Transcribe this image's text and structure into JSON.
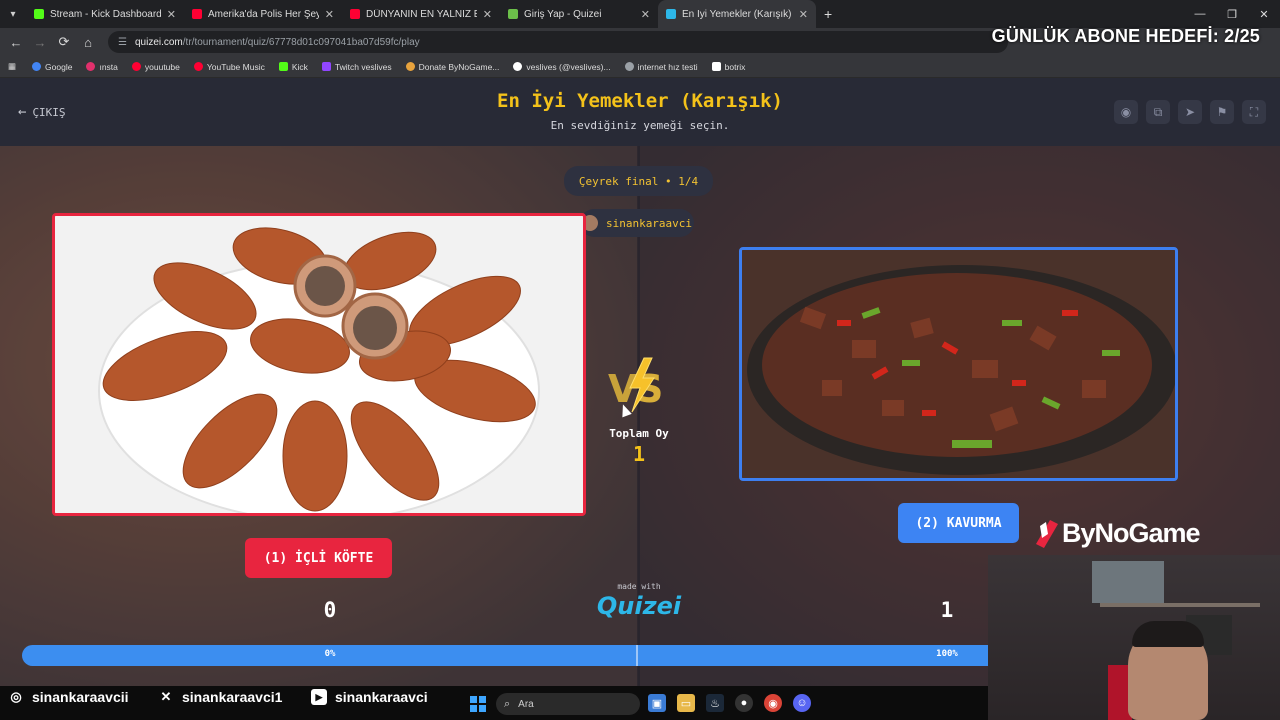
{
  "browser": {
    "tabs": [
      {
        "title": "Stream - Kick Dashboard",
        "color": "#53fc18",
        "active": false
      },
      {
        "title": "Amerika'da Polis Her Şeyi Görü",
        "color": "#ff0033",
        "active": false
      },
      {
        "title": "DÜNYANIN EN YALNIZ EVİNDE",
        "color": "#ff0033",
        "active": false
      },
      {
        "title": "Giriş Yap - Quizei",
        "color": "#6cc04a",
        "active": false
      },
      {
        "title": "En İyi Yemekler (Karışık) - Tier L",
        "color": "#2db7e8",
        "active": true
      }
    ],
    "url_site": "quizei.com",
    "url_path": "/tr/tournament/quiz/67778d01c097041ba07d59fc/play",
    "bookmarks": [
      {
        "label": "Google",
        "color": "#4285f4"
      },
      {
        "label": "ınsta",
        "color": "#e1306c"
      },
      {
        "label": "youutube",
        "color": "#ff0033"
      },
      {
        "label": "YouTube Music",
        "color": "#ff0033"
      },
      {
        "label": "Kick",
        "color": "#53fc18"
      },
      {
        "label": "Twitch veslives",
        "color": "#9146ff"
      },
      {
        "label": "Donate ByNoGame...",
        "color": "#e8a33d"
      },
      {
        "label": "veslives (@veslives)...",
        "color": "#ffffff"
      },
      {
        "label": "internet hız testi",
        "color": "#9aa0a6"
      },
      {
        "label": "botrix",
        "color": "#ffffff"
      }
    ]
  },
  "overlay": {
    "goal_text": "GÜNLÜK ABONE HEDEFİ: 2/25"
  },
  "quiz": {
    "exit_label": "ÇIKIŞ",
    "title": "En İyi Yemekler (Karışık)",
    "subtitle": "En sevdiğiniz yemeği seçin.",
    "round_label": "Çeyrek final • 1/4",
    "author": "sinankaraavci",
    "total_votes_label": "Toplam Oy",
    "total_votes": "1",
    "left_option": {
      "label": "(1) İÇLİ KÖFTE",
      "votes": "0",
      "percent": "0%",
      "fraction": 0
    },
    "right_option": {
      "label": "(2) KAVURMA",
      "votes": "1",
      "percent": "100%",
      "fraction": 1
    },
    "made_with": "made with",
    "brand": "Quizei",
    "accent_left": "#e8253f",
    "accent_right": "#3d84f3",
    "title_color": "#f4c21a"
  },
  "sponsor": "ByNoGame",
  "social": [
    {
      "icon": "instagram-icon",
      "handle": "sinankaraavcii"
    },
    {
      "icon": "x-icon",
      "handle": "sinankaraavci1"
    },
    {
      "icon": "youtube-icon",
      "handle": "sinankaraavci"
    }
  ],
  "taskbar": {
    "search_placeholder": "Ara"
  }
}
